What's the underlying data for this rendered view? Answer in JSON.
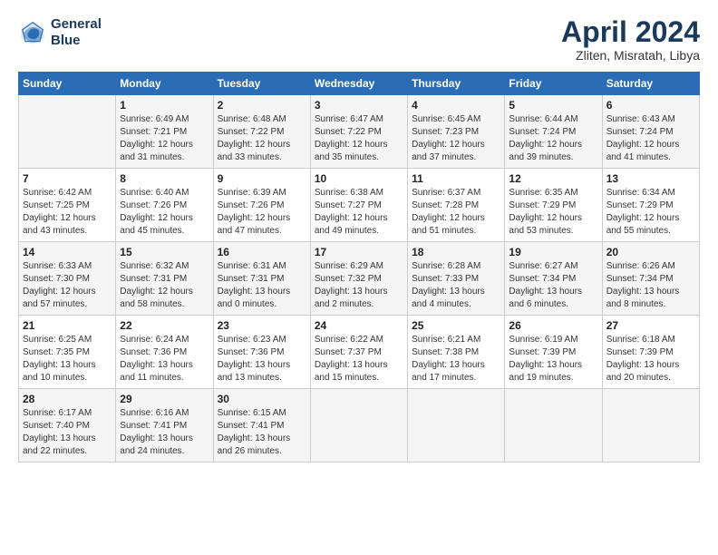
{
  "logo": {
    "line1": "General",
    "line2": "Blue"
  },
  "title": "April 2024",
  "subtitle": "Zliten, Misratah, Libya",
  "headers": [
    "Sunday",
    "Monday",
    "Tuesday",
    "Wednesday",
    "Thursday",
    "Friday",
    "Saturday"
  ],
  "weeks": [
    [
      {
        "day": "",
        "sunrise": "",
        "sunset": "",
        "daylight": ""
      },
      {
        "day": "1",
        "sunrise": "Sunrise: 6:49 AM",
        "sunset": "Sunset: 7:21 PM",
        "daylight": "Daylight: 12 hours and 31 minutes."
      },
      {
        "day": "2",
        "sunrise": "Sunrise: 6:48 AM",
        "sunset": "Sunset: 7:22 PM",
        "daylight": "Daylight: 12 hours and 33 minutes."
      },
      {
        "day": "3",
        "sunrise": "Sunrise: 6:47 AM",
        "sunset": "Sunset: 7:22 PM",
        "daylight": "Daylight: 12 hours and 35 minutes."
      },
      {
        "day": "4",
        "sunrise": "Sunrise: 6:45 AM",
        "sunset": "Sunset: 7:23 PM",
        "daylight": "Daylight: 12 hours and 37 minutes."
      },
      {
        "day": "5",
        "sunrise": "Sunrise: 6:44 AM",
        "sunset": "Sunset: 7:24 PM",
        "daylight": "Daylight: 12 hours and 39 minutes."
      },
      {
        "day": "6",
        "sunrise": "Sunrise: 6:43 AM",
        "sunset": "Sunset: 7:24 PM",
        "daylight": "Daylight: 12 hours and 41 minutes."
      }
    ],
    [
      {
        "day": "7",
        "sunrise": "Sunrise: 6:42 AM",
        "sunset": "Sunset: 7:25 PM",
        "daylight": "Daylight: 12 hours and 43 minutes."
      },
      {
        "day": "8",
        "sunrise": "Sunrise: 6:40 AM",
        "sunset": "Sunset: 7:26 PM",
        "daylight": "Daylight: 12 hours and 45 minutes."
      },
      {
        "day": "9",
        "sunrise": "Sunrise: 6:39 AM",
        "sunset": "Sunset: 7:26 PM",
        "daylight": "Daylight: 12 hours and 47 minutes."
      },
      {
        "day": "10",
        "sunrise": "Sunrise: 6:38 AM",
        "sunset": "Sunset: 7:27 PM",
        "daylight": "Daylight: 12 hours and 49 minutes."
      },
      {
        "day": "11",
        "sunrise": "Sunrise: 6:37 AM",
        "sunset": "Sunset: 7:28 PM",
        "daylight": "Daylight: 12 hours and 51 minutes."
      },
      {
        "day": "12",
        "sunrise": "Sunrise: 6:35 AM",
        "sunset": "Sunset: 7:29 PM",
        "daylight": "Daylight: 12 hours and 53 minutes."
      },
      {
        "day": "13",
        "sunrise": "Sunrise: 6:34 AM",
        "sunset": "Sunset: 7:29 PM",
        "daylight": "Daylight: 12 hours and 55 minutes."
      }
    ],
    [
      {
        "day": "14",
        "sunrise": "Sunrise: 6:33 AM",
        "sunset": "Sunset: 7:30 PM",
        "daylight": "Daylight: 12 hours and 57 minutes."
      },
      {
        "day": "15",
        "sunrise": "Sunrise: 6:32 AM",
        "sunset": "Sunset: 7:31 PM",
        "daylight": "Daylight: 12 hours and 58 minutes."
      },
      {
        "day": "16",
        "sunrise": "Sunrise: 6:31 AM",
        "sunset": "Sunset: 7:31 PM",
        "daylight": "Daylight: 13 hours and 0 minutes."
      },
      {
        "day": "17",
        "sunrise": "Sunrise: 6:29 AM",
        "sunset": "Sunset: 7:32 PM",
        "daylight": "Daylight: 13 hours and 2 minutes."
      },
      {
        "day": "18",
        "sunrise": "Sunrise: 6:28 AM",
        "sunset": "Sunset: 7:33 PM",
        "daylight": "Daylight: 13 hours and 4 minutes."
      },
      {
        "day": "19",
        "sunrise": "Sunrise: 6:27 AM",
        "sunset": "Sunset: 7:34 PM",
        "daylight": "Daylight: 13 hours and 6 minutes."
      },
      {
        "day": "20",
        "sunrise": "Sunrise: 6:26 AM",
        "sunset": "Sunset: 7:34 PM",
        "daylight": "Daylight: 13 hours and 8 minutes."
      }
    ],
    [
      {
        "day": "21",
        "sunrise": "Sunrise: 6:25 AM",
        "sunset": "Sunset: 7:35 PM",
        "daylight": "Daylight: 13 hours and 10 minutes."
      },
      {
        "day": "22",
        "sunrise": "Sunrise: 6:24 AM",
        "sunset": "Sunset: 7:36 PM",
        "daylight": "Daylight: 13 hours and 11 minutes."
      },
      {
        "day": "23",
        "sunrise": "Sunrise: 6:23 AM",
        "sunset": "Sunset: 7:36 PM",
        "daylight": "Daylight: 13 hours and 13 minutes."
      },
      {
        "day": "24",
        "sunrise": "Sunrise: 6:22 AM",
        "sunset": "Sunset: 7:37 PM",
        "daylight": "Daylight: 13 hours and 15 minutes."
      },
      {
        "day": "25",
        "sunrise": "Sunrise: 6:21 AM",
        "sunset": "Sunset: 7:38 PM",
        "daylight": "Daylight: 13 hours and 17 minutes."
      },
      {
        "day": "26",
        "sunrise": "Sunrise: 6:19 AM",
        "sunset": "Sunset: 7:39 PM",
        "daylight": "Daylight: 13 hours and 19 minutes."
      },
      {
        "day": "27",
        "sunrise": "Sunrise: 6:18 AM",
        "sunset": "Sunset: 7:39 PM",
        "daylight": "Daylight: 13 hours and 20 minutes."
      }
    ],
    [
      {
        "day": "28",
        "sunrise": "Sunrise: 6:17 AM",
        "sunset": "Sunset: 7:40 PM",
        "daylight": "Daylight: 13 hours and 22 minutes."
      },
      {
        "day": "29",
        "sunrise": "Sunrise: 6:16 AM",
        "sunset": "Sunset: 7:41 PM",
        "daylight": "Daylight: 13 hours and 24 minutes."
      },
      {
        "day": "30",
        "sunrise": "Sunrise: 6:15 AM",
        "sunset": "Sunset: 7:41 PM",
        "daylight": "Daylight: 13 hours and 26 minutes."
      },
      {
        "day": "",
        "sunrise": "",
        "sunset": "",
        "daylight": ""
      },
      {
        "day": "",
        "sunrise": "",
        "sunset": "",
        "daylight": ""
      },
      {
        "day": "",
        "sunrise": "",
        "sunset": "",
        "daylight": ""
      },
      {
        "day": "",
        "sunrise": "",
        "sunset": "",
        "daylight": ""
      }
    ]
  ]
}
